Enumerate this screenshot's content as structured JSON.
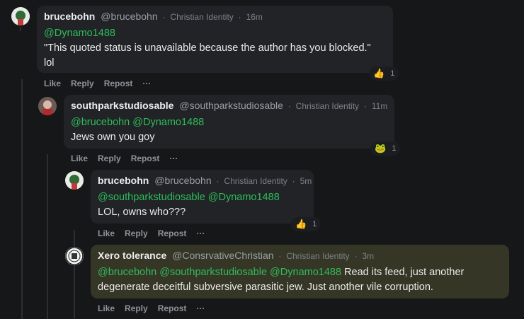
{
  "comments": [
    {
      "name": "brucebohn",
      "handle": "@brucebohn",
      "group": "Christian Identity",
      "time": "16m",
      "mentions": "@Dynamo1488",
      "body_line1": "\"This quoted status is unavailable because the author has you blocked.\"",
      "body_line2": "lol",
      "reaction_emoji": "👍",
      "reaction_count": "1"
    },
    {
      "name": "southparkstudiosable",
      "handle": "@southparkstudiosable",
      "group": "Christian Identity",
      "time": "11m",
      "mentions": "@brucebohn @Dynamo1488",
      "body_line1": "Jews own you goy",
      "reaction_emoji": "🐸",
      "reaction_count": "1"
    },
    {
      "name": "brucebohn",
      "handle": "@brucebohn",
      "group": "Christian Identity",
      "time": "5m",
      "mentions": "@southparkstudiosable @Dynamo1488",
      "body_line1": "LOL, owns who???",
      "reaction_emoji": "👍",
      "reaction_count": "1"
    },
    {
      "name": "Xero tolerance",
      "handle": "@ConsrvativeChristian",
      "group": "Christian Identity",
      "time": "3m",
      "mentions": "@brucebohn @southparkstudiosable @Dynamo1488",
      "body_line1": " Read its feed, just another",
      "body_line2": "degenerate deceitful subversive parasitic jew. Just another vile corruption."
    }
  ],
  "actions": {
    "like": "Like",
    "reply": "Reply",
    "repost": "Repost",
    "more": "···"
  },
  "dot": "·"
}
